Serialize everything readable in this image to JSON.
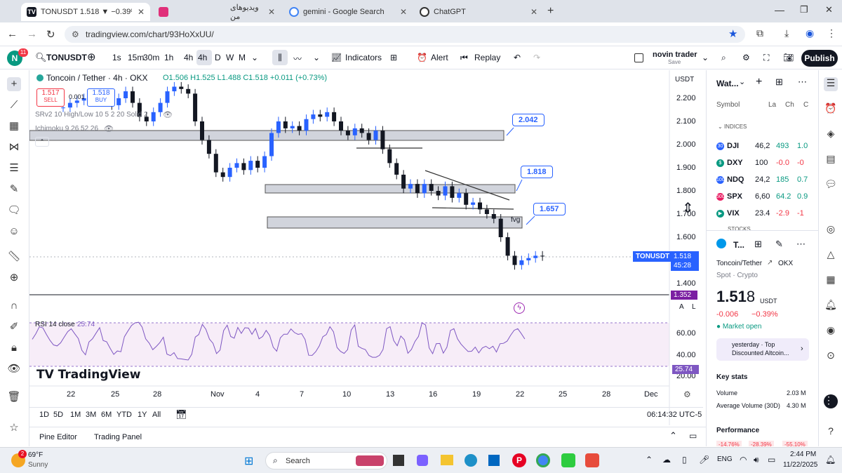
{
  "browser": {
    "tabs": [
      {
        "title": "TONUSDT 1.518 ▼ −0.39% nov",
        "color": "#131722"
      },
      {
        "title": "",
        "color": "#e0307a"
      },
      {
        "title": "ویدیوهای من",
        "color": "#ffffff"
      },
      {
        "title": "gemini - Google Search",
        "color": "#4285f4"
      },
      {
        "title": "ChatGPT",
        "color": "#333333"
      }
    ],
    "url": "tradingview.com/chart/93HoXxUU/"
  },
  "toolbar": {
    "avatar_letter": "N",
    "avatar_badge": "11",
    "symbol": "TONUSDT",
    "intervals": [
      "1s",
      "15m",
      "30m",
      "1h",
      "4h",
      "D",
      "W",
      "M"
    ],
    "active_interval": "4h",
    "indicators_label": "Indicators",
    "alert_label": "Alert",
    "replay_label": "Replay",
    "layout_name": "novin trader",
    "layout_sub": "Save",
    "publish_label": "Publish"
  },
  "chart": {
    "title": "Toncoin / Tether · 4h · OKX",
    "ohlc": "O1.506 H1.525 L1.488 C1.518 +0.011 (+0.73%)",
    "sell_price": "1.517",
    "sell_label": "SELL",
    "spread": "0.001",
    "buy_price": "1.518",
    "buy_label": "BUY",
    "indicator_1": "SRv2 10 High/Low 10 5 2 20 Solid 2",
    "indicator_2": "Ichimoku 9 26 52 26",
    "currency": "USDT",
    "price_ticks": [
      "2.200",
      "2.100",
      "2.000",
      "1.900",
      "1.800",
      "1.700",
      "1.600",
      "1.400"
    ],
    "current_label": "TONUSDT",
    "current_price": "1.518",
    "countdown": "45:28",
    "lower_price": "1.352",
    "annotations": [
      "2.042",
      "1.818",
      "1.657"
    ],
    "fvg_label": "fvg",
    "rsi_label": "RSI 14 close",
    "rsi_value": "25.74",
    "rsi_ticks": [
      "60.00",
      "40.00",
      "20.00"
    ],
    "watermark": "TradingView",
    "x_ticks": [
      "22",
      "25",
      "28",
      "Nov",
      "4",
      "7",
      "10",
      "13",
      "16",
      "19",
      "22",
      "25",
      "28",
      "Dec"
    ],
    "scale_a": "A",
    "scale_l": "L",
    "close_series": [
      2.16,
      2.18,
      2.19,
      2.2,
      2.21,
      2.22,
      2.21,
      2.17,
      2.2,
      2.23,
      2.18,
      2.12,
      2.1,
      2.14,
      2.18,
      2.23,
      2.25,
      2.24,
      2.22,
      2.1,
      2.02,
      1.96,
      1.88,
      1.86,
      1.9,
      1.92,
      1.89,
      1.93,
      1.9,
      1.95,
      2.05,
      2.1,
      2.07,
      2.08,
      2.06,
      2.11,
      2.13,
      2.12,
      2.14,
      2.1,
      2.06,
      2.04,
      2.07,
      2.05,
      2.02,
      2.06,
      1.98,
      1.92,
      1.87,
      1.81,
      1.83,
      1.79,
      1.83,
      1.8,
      1.78,
      1.82,
      1.77,
      1.79,
      1.74,
      1.75,
      1.72,
      1.7,
      1.68,
      1.6,
      1.52,
      1.48,
      1.5,
      1.51,
      1.52,
      1.518
    ]
  },
  "range_bar": {
    "ranges": [
      "1D",
      "5D",
      "1M",
      "3M",
      "6M",
      "YTD",
      "1Y",
      "All"
    ],
    "time": "06:14:32 UTC-5"
  },
  "panels": {
    "pine": "Pine Editor",
    "trading": "Trading Panel"
  },
  "watchlist": {
    "title": "Wat...",
    "col_symbol": "Symbol",
    "col_last": "La",
    "col_chg": "Ch",
    "col_chgp": "C",
    "section": "INDICES",
    "rows": [
      {
        "badge": "30",
        "symbol": "DJI",
        "last": "46,2",
        "chg": "493",
        "chgp": "1.0",
        "color": "#2962ff",
        "up": true
      },
      {
        "badge": "$",
        "symbol": "DXY",
        "last": "100",
        "chg": "-0.0",
        "chgp": "-0",
        "color": "#089981",
        "up": false
      },
      {
        "badge": "100",
        "symbol": "NDQ",
        "last": "24,2",
        "chg": "185",
        "chgp": "0.7",
        "color": "#2962ff",
        "up": true
      },
      {
        "badge": "500",
        "symbol": "SPX",
        "last": "6,60",
        "chg": "64.2",
        "chgp": "0.9",
        "color": "#e91e63",
        "up": true
      },
      {
        "badge": "▶",
        "symbol": "VIX",
        "last": "23.4",
        "chg": "-2.9",
        "chgp": "-1",
        "color": "#089981",
        "up": false
      }
    ],
    "section2": "STOCKS"
  },
  "details": {
    "symbol_short": "T...",
    "name": "Toncoin/Tether",
    "exchange": "OKX",
    "type": "Spot · Crypto",
    "price_main": "1.51",
    "price_last": "8",
    "currency": "USDT",
    "change": "-0.006",
    "change_pct": "−0.39%",
    "market_status": "Market open",
    "news_prefix": "yesterday · Top",
    "news_title": "Discounted Altcoin...",
    "key_stats": "Key stats",
    "volume_label": "Volume",
    "volume_value": "2.03 M",
    "avg_volume_label": "Average Volume (30D)",
    "avg_volume_value": "4.30 M",
    "performance": "Performance",
    "perf_values": [
      "-14.76%",
      "-28.39%",
      "-55.10%"
    ]
  },
  "taskbar": {
    "weather_temp": "69°F",
    "weather_desc": "Sunny",
    "weather_badge": "2",
    "search": "Search",
    "lang": "ENG",
    "time": "2:44 PM",
    "date": "11/22/2025"
  },
  "colors": {
    "up": "#089981",
    "down": "#f23645",
    "accent": "#2962ff",
    "rsi": "#7e57c2"
  }
}
